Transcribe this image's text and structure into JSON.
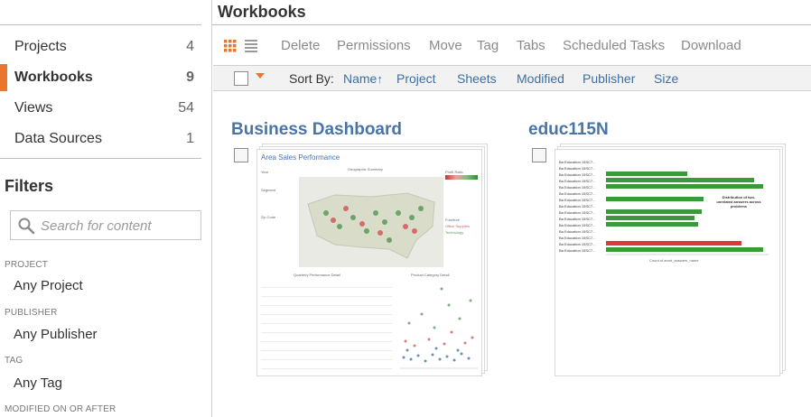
{
  "sidebar": {
    "nav": [
      {
        "label": "Projects",
        "count": "4"
      },
      {
        "label": "Workbooks",
        "count": "9",
        "active": true
      },
      {
        "label": "Views",
        "count": "54"
      },
      {
        "label": "Data Sources",
        "count": "1"
      }
    ],
    "filters_title": "Filters",
    "search_placeholder": "Search for content",
    "filters": [
      {
        "label": "PROJECT",
        "value": "Any Project"
      },
      {
        "label": "PUBLISHER",
        "value": "Any Publisher"
      },
      {
        "label": "TAG",
        "value": "Any Tag"
      },
      {
        "label": "MODIFIED ON OR AFTER",
        "value": ""
      }
    ]
  },
  "header": {
    "title": "Workbooks"
  },
  "toolbar": {
    "actions": [
      "Delete",
      "Permissions",
      "Move",
      "Tag",
      "Tabs",
      "Scheduled Tasks",
      "Download"
    ]
  },
  "sortbar": {
    "label": "Sort By:",
    "options": [
      "Name",
      "Project",
      "Sheets",
      "Modified",
      "Publisher",
      "Size"
    ],
    "active_arrow": "↑"
  },
  "workbooks": [
    {
      "name": "Business Dashboard",
      "thumb": {
        "title": "Area Sales Performance",
        "panel_map": "Geographic Summary",
        "panel_table": "Quarterly Performance Detail",
        "panel_scatter": "Product Category Detail",
        "legend": [
          "Furniture",
          "Office Supplies",
          "Technology"
        ]
      }
    },
    {
      "name": "educ115N",
      "thumb": {
        "title": "Distribution of two-unrelated answers across problems",
        "axis": "Count of amnt_answers_name"
      }
    }
  ],
  "colors": {
    "accent": "#e8762c",
    "link": "#3d6fa3",
    "card_title": "#4a73a8",
    "bar_green": "#3a9a3a",
    "bar_red": "#d73a3a"
  },
  "icons": [
    "grid-view-icon",
    "list-view-icon",
    "search-icon",
    "caret-down-icon"
  ]
}
